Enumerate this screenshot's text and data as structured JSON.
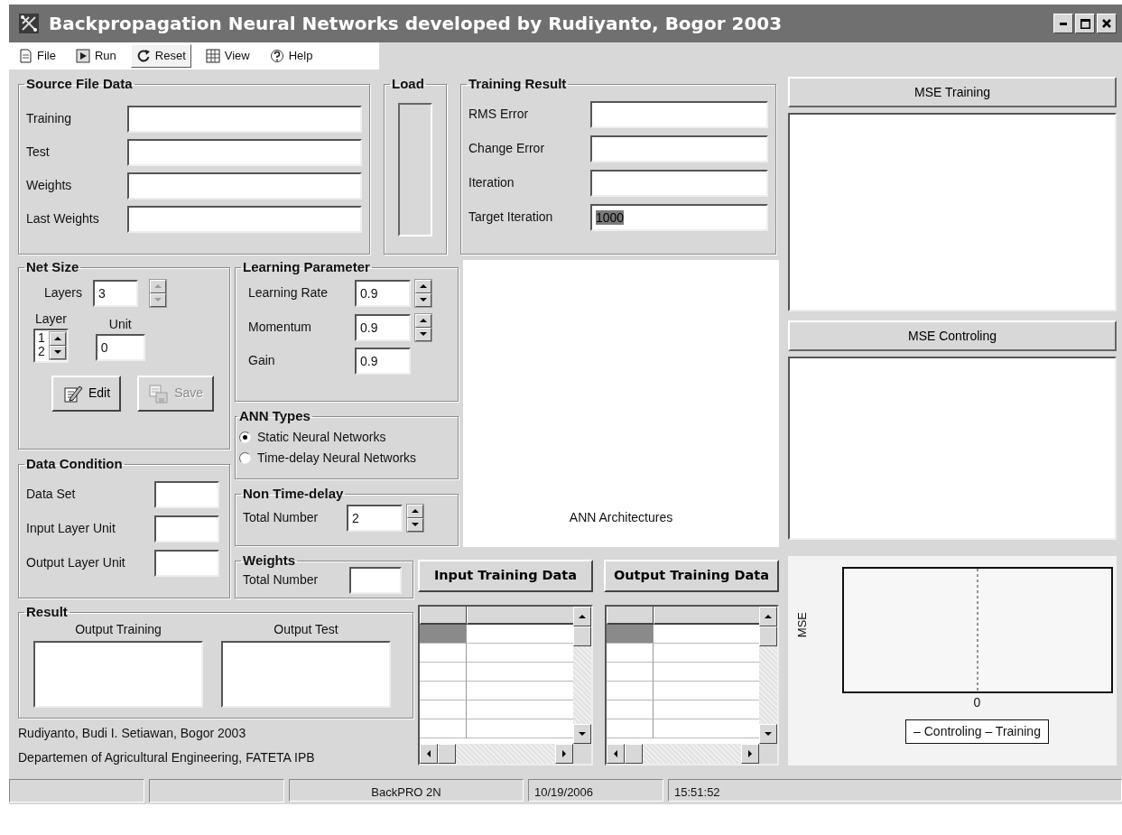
{
  "window": {
    "title": "Backpropagation Neural Networks developed by Rudiyanto, Bogor 2003"
  },
  "menu": [
    {
      "label": "File",
      "selected": false
    },
    {
      "label": "Run",
      "selected": false
    },
    {
      "label": "Reset",
      "selected": true
    },
    {
      "label": "View",
      "selected": false
    },
    {
      "label": "Help",
      "selected": false
    }
  ],
  "source_file_data": {
    "title": "Source File Data",
    "fields": [
      {
        "label": "Training"
      },
      {
        "label": "Test"
      },
      {
        "label": "Weights"
      },
      {
        "label": "Last Weights"
      }
    ]
  },
  "load": {
    "title": "Load",
    "level": 0
  },
  "training_result": {
    "title": "Training Result",
    "fields": [
      {
        "label": "RMS Error"
      },
      {
        "label": "Change Error"
      },
      {
        "label": "Iteration"
      },
      {
        "label": "Target Iteration",
        "value": "1000",
        "text_selected": true
      }
    ]
  },
  "net_size": {
    "title": "Net Size",
    "layers": {
      "label": "Layers",
      "value": "3",
      "disabled": true
    },
    "layer": {
      "label": "Layer",
      "items": [
        "1",
        "2"
      ]
    },
    "unit": {
      "label": "Unit",
      "value": "0"
    },
    "buttons": [
      {
        "label": "Edit",
        "disabled": false
      },
      {
        "label": "Save",
        "disabled": true
      }
    ]
  },
  "data_condition": {
    "title": "Data Condition",
    "fields": [
      {
        "label": "Data Set"
      },
      {
        "label": "Input Layer Unit"
      },
      {
        "label": "Output Layer Unit"
      }
    ]
  },
  "learning_parameter": {
    "title": "Learning Parameter",
    "fields": [
      {
        "label": "Learning Rate",
        "value": "0.9",
        "kind": "spinner"
      },
      {
        "label": "Momentum",
        "value": "0.9",
        "kind": "spinner"
      },
      {
        "label": "Gain",
        "value": "0.9",
        "kind": "text"
      }
    ]
  },
  "ann_types": {
    "title": "ANN Types",
    "options": [
      {
        "label": "Static Neural Networks",
        "selected": true
      },
      {
        "label": "Time-delay Neural Networks",
        "selected": false
      }
    ]
  },
  "non_time_delay": {
    "title": "Non Time-delay",
    "label": "Total Number",
    "value": "2"
  },
  "weights": {
    "title": "Weights",
    "label": "Total Number"
  },
  "architecture_panel": {
    "caption": "ANN Architectures"
  },
  "data_buttons": [
    "Input Training Data",
    "Output Training Data"
  ],
  "data_grids": [
    {
      "rows": [
        {
          "selected": true
        },
        {
          "selected": false
        },
        {
          "selected": false
        },
        {
          "selected": false
        },
        {
          "selected": false
        },
        {
          "selected": false
        }
      ]
    },
    {
      "rows": [
        {
          "selected": true
        },
        {
          "selected": false
        },
        {
          "selected": false
        },
        {
          "selected": false
        },
        {
          "selected": false
        },
        {
          "selected": false
        }
      ]
    }
  ],
  "result": {
    "title": "Result",
    "outputs": [
      "Output Training",
      "Output Test"
    ]
  },
  "credits": [
    "Rudiyanto, Budi I. Setiawan, Bogor 2003",
    "Departemen of Agricultural Engineering, FATETA IPB"
  ],
  "mse_panels": [
    {
      "button": "MSE Training"
    },
    {
      "button": "MSE Controling"
    }
  ],
  "mse_chart": {
    "ylabel": "MSE",
    "xtick": "0",
    "legend": "– Controling – Training"
  },
  "status_bar": [
    "BackPRO 2N",
    "10/19/2006",
    "15:51:52"
  ]
}
